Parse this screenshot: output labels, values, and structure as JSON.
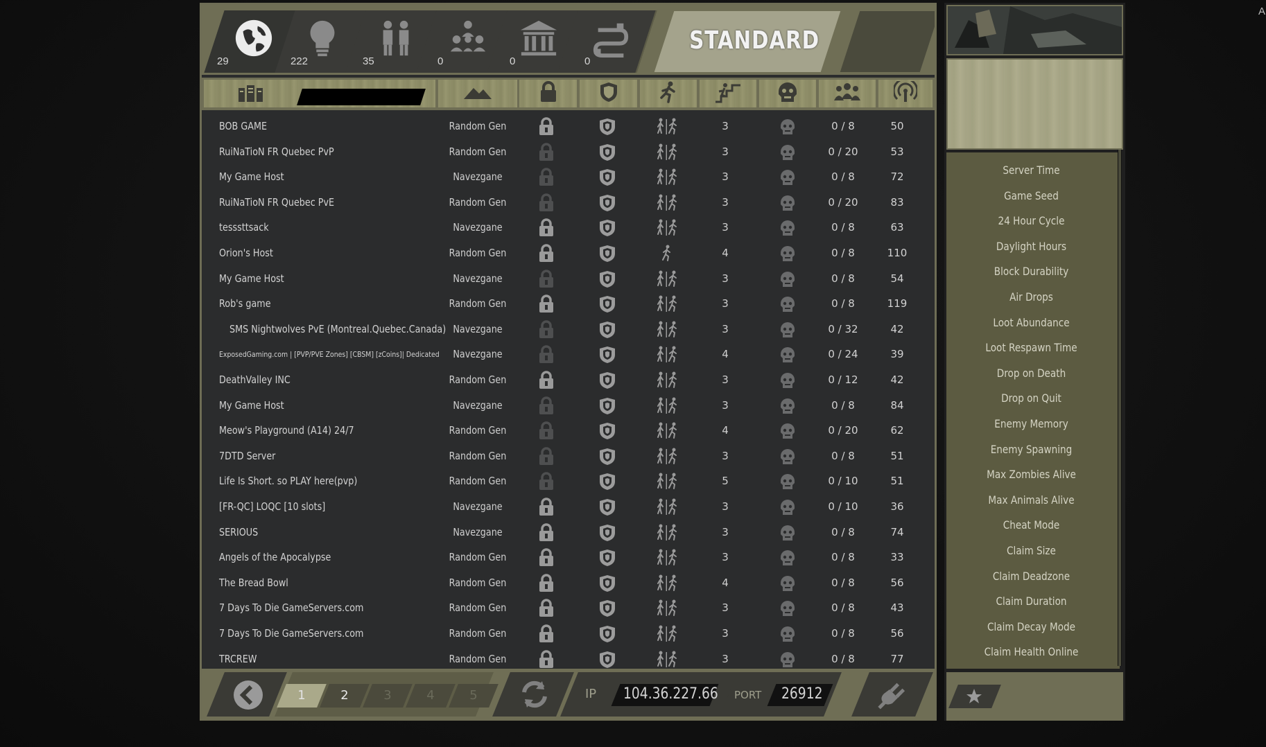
{
  "corner_text": "Al",
  "filters": [
    {
      "name": "globe-icon",
      "count": "29"
    },
    {
      "name": "lightbulb-icon",
      "count": "222"
    },
    {
      "name": "friends-icon",
      "count": "35"
    },
    {
      "name": "group-icon",
      "count": "0"
    },
    {
      "name": "museum-icon",
      "count": "0"
    },
    {
      "name": "lan-icon",
      "count": "0"
    }
  ],
  "mode_button": "STANDARD",
  "columns": [
    "server-icon",
    "world-icon",
    "lock-icon",
    "shield-icon",
    "run-icon",
    "difficulty-icon",
    "zombie-icon",
    "players-icon",
    "ping-icon"
  ],
  "servers": [
    {
      "name": "BOB GAME",
      "world": "Random Gen",
      "locked": true,
      "run": "pair",
      "difficulty": "3",
      "players": "0 / 8",
      "ping": "50"
    },
    {
      "name": "RuiNaTioN FR Quebec PvP",
      "world": "Random Gen",
      "locked": false,
      "run": "pair",
      "difficulty": "3",
      "players": "0 / 20",
      "ping": "53"
    },
    {
      "name": "My Game Host",
      "world": "Navezgane",
      "locked": false,
      "run": "pair",
      "difficulty": "3",
      "players": "0 / 8",
      "ping": "72"
    },
    {
      "name": "RuiNaTioN FR Quebec PvE",
      "world": "Random Gen",
      "locked": false,
      "run": "pair",
      "difficulty": "3",
      "players": "0 / 20",
      "ping": "83"
    },
    {
      "name": "tesssttsack",
      "world": "Navezgane",
      "locked": true,
      "run": "pair",
      "difficulty": "3",
      "players": "0 / 8",
      "ping": "63"
    },
    {
      "name": "Orion's Host",
      "world": "Random Gen",
      "locked": true,
      "run": "single",
      "difficulty": "4",
      "players": "0 / 8",
      "ping": "110"
    },
    {
      "name": "My Game Host",
      "world": "Navezgane",
      "locked": false,
      "run": "pair",
      "difficulty": "3",
      "players": "0 / 8",
      "ping": "54"
    },
    {
      "name": "Rob's game",
      "world": "Random Gen",
      "locked": true,
      "run": "pair",
      "difficulty": "3",
      "players": "0 / 8",
      "ping": "119"
    },
    {
      "name": "SMS Nightwolves PvE (Montreal.Quebec.Canada)",
      "world": "Navezgane",
      "locked": false,
      "run": "pair",
      "difficulty": "3",
      "players": "0 / 32",
      "ping": "42",
      "indent": true
    },
    {
      "name": "ExposedGaming.com | [PVP/PVE Zones] [CBSM] [zCoins]| Dedicated",
      "world": "Navezgane",
      "locked": false,
      "run": "pair",
      "difficulty": "4",
      "players": "0 / 24",
      "ping": "39",
      "small": true
    },
    {
      "name": "DeathValley INC",
      "world": "Random Gen",
      "locked": true,
      "run": "pair",
      "difficulty": "3",
      "players": "0 / 12",
      "ping": "42"
    },
    {
      "name": "My Game Host",
      "world": "Navezgane",
      "locked": false,
      "run": "pair",
      "difficulty": "3",
      "players": "0 / 8",
      "ping": "84"
    },
    {
      "name": "Meow's Playground (A14) 24/7",
      "world": "Random Gen",
      "locked": false,
      "run": "pair",
      "difficulty": "4",
      "players": "0 / 20",
      "ping": "62"
    },
    {
      "name": "7DTD Server",
      "world": "Random Gen",
      "locked": false,
      "run": "pair",
      "difficulty": "3",
      "players": "0 / 8",
      "ping": "51"
    },
    {
      "name": "Life Is Short. so PLAY here(pvp)",
      "world": "Random Gen",
      "locked": false,
      "run": "pair",
      "difficulty": "5",
      "players": "0 / 10",
      "ping": "51"
    },
    {
      "name": "[FR-QC] LOQC [10 slots]",
      "world": "Navezgane",
      "locked": true,
      "run": "pair",
      "difficulty": "3",
      "players": "0 / 10",
      "ping": "36"
    },
    {
      "name": "SERIOUS",
      "world": "Navezgane",
      "locked": true,
      "run": "pair",
      "difficulty": "3",
      "players": "0 / 8",
      "ping": "74"
    },
    {
      "name": "Angels of the Apocalypse",
      "world": "Random Gen",
      "locked": true,
      "run": "pair",
      "difficulty": "3",
      "players": "0 / 8",
      "ping": "33"
    },
    {
      "name": "The Bread Bowl",
      "world": "Random Gen",
      "locked": true,
      "run": "pair",
      "difficulty": "4",
      "players": "0 / 8",
      "ping": "56"
    },
    {
      "name": "7 Days To Die GameServers.com",
      "world": "Random Gen",
      "locked": true,
      "run": "pair",
      "difficulty": "3",
      "players": "0 / 8",
      "ping": "43"
    },
    {
      "name": "7 Days To Die GameServers.com",
      "world": "Random Gen",
      "locked": true,
      "run": "pair",
      "difficulty": "3",
      "players": "0 / 8",
      "ping": "56"
    },
    {
      "name": "TRCREW",
      "world": "Random Gen",
      "locked": true,
      "run": "pair",
      "difficulty": "3",
      "players": "0 / 8",
      "ping": "77"
    }
  ],
  "pagination": {
    "pages": [
      "1",
      "2",
      "3",
      "4",
      "5"
    ],
    "current": "1"
  },
  "connect": {
    "ip_label": "IP",
    "ip": "104.36.227.66",
    "port_label": "PORT",
    "port": "26912"
  },
  "server_info_labels": [
    "Server Time",
    "Game Seed",
    "24 Hour Cycle",
    "Daylight Hours",
    "Block Durability",
    "Air Drops",
    "Loot Abundance",
    "Loot Respawn Time",
    "Drop on Death",
    "Drop on Quit",
    "Enemy Memory",
    "Enemy Spawning",
    "Max Zombies Alive",
    "Max Animals Alive",
    "Cheat Mode",
    "Claim Size",
    "Claim Deadzone",
    "Claim Duration",
    "Claim Decay Mode",
    "Claim Health Online"
  ],
  "colors": {
    "olive": "#6f6e55",
    "panel": "#2b2c2d",
    "text": "#d2d2d2",
    "standard": "#a4a38c"
  }
}
